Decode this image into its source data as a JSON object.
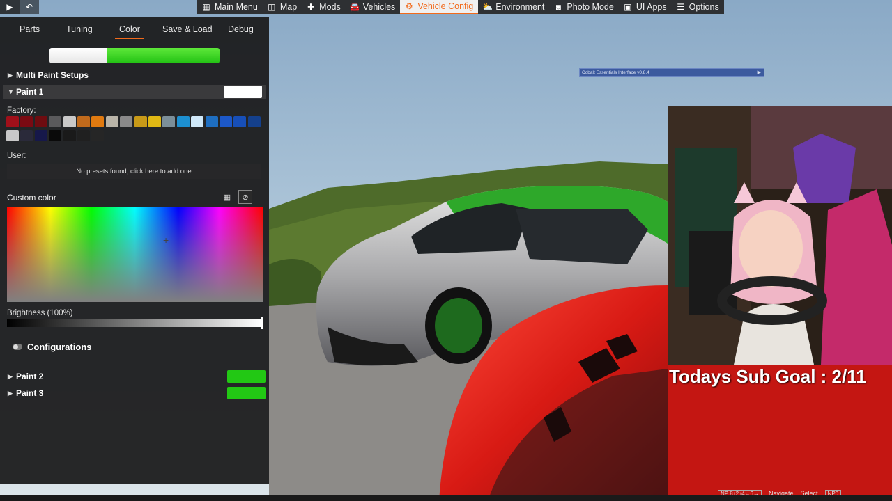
{
  "topbar": {
    "menu": [
      {
        "icon": "apps-icon",
        "glyph": "▦",
        "label": "Main Menu"
      },
      {
        "icon": "map-icon",
        "glyph": "◫",
        "label": "Map"
      },
      {
        "icon": "puzzle-icon",
        "glyph": "✚",
        "label": "Mods"
      },
      {
        "icon": "car-icon",
        "glyph": "🚘",
        "label": "Vehicles"
      },
      {
        "icon": "car-config-icon",
        "glyph": "⚙",
        "label": "Vehicle Config"
      },
      {
        "icon": "weather-icon",
        "glyph": "⛅",
        "label": "Environment"
      },
      {
        "icon": "camera-icon",
        "glyph": "◙",
        "label": "Photo Mode"
      },
      {
        "icon": "ui-apps-icon",
        "glyph": "▣",
        "label": "UI Apps"
      },
      {
        "icon": "sliders-icon",
        "glyph": "☰",
        "label": "Options"
      }
    ]
  },
  "panel": {
    "tabs": [
      "Parts",
      "Tuning",
      "Color",
      "Save & Load",
      "Debug"
    ],
    "active_tab": "Color",
    "multi_paint_label": "Multi Paint Setups",
    "paint1_label": "Paint 1",
    "factory_label": "Factory:",
    "user_label": "User:",
    "no_presets": "No presets found, click here to add one",
    "custom_color_label": "Custom color",
    "brightness_label": "Brightness (100%)",
    "configurations_label": "Configurations",
    "paint2_label": "Paint 2",
    "paint3_label": "Paint 3",
    "factory_colors": [
      "#a0101a",
      "#7a0a12",
      "#6e0c10",
      "#5a5a5c",
      "#c9c9c9",
      "#c06a1c",
      "#e07a10",
      "#b9b4a8",
      "#8a8a8a",
      "#c89a18",
      "#e0b814",
      "#7b8e98",
      "#1c8fd0",
      "#cfe8f8",
      "#1e6ec0",
      "#1c58c8",
      "#174fb8",
      "#14408c",
      "#c8c8c8",
      "#2a2a3a",
      "#16184a",
      "#0a0a0a",
      "#1a1a1a",
      "#202020",
      "#262626"
    ],
    "paint1_color": "#ffffff",
    "paint2_color": "#22c814",
    "paint3_color": "#22c814"
  },
  "overlays": {
    "cobalt_label": "Cobalt Essentials Interface v0.8.4",
    "sub_goal": "Todays Sub Goal : 2/11",
    "hint_keys": "NP 8↑2↓4←6→",
    "hint_navigate": "Navigate",
    "hint_select": "Select",
    "hint_np0": "NP0"
  }
}
